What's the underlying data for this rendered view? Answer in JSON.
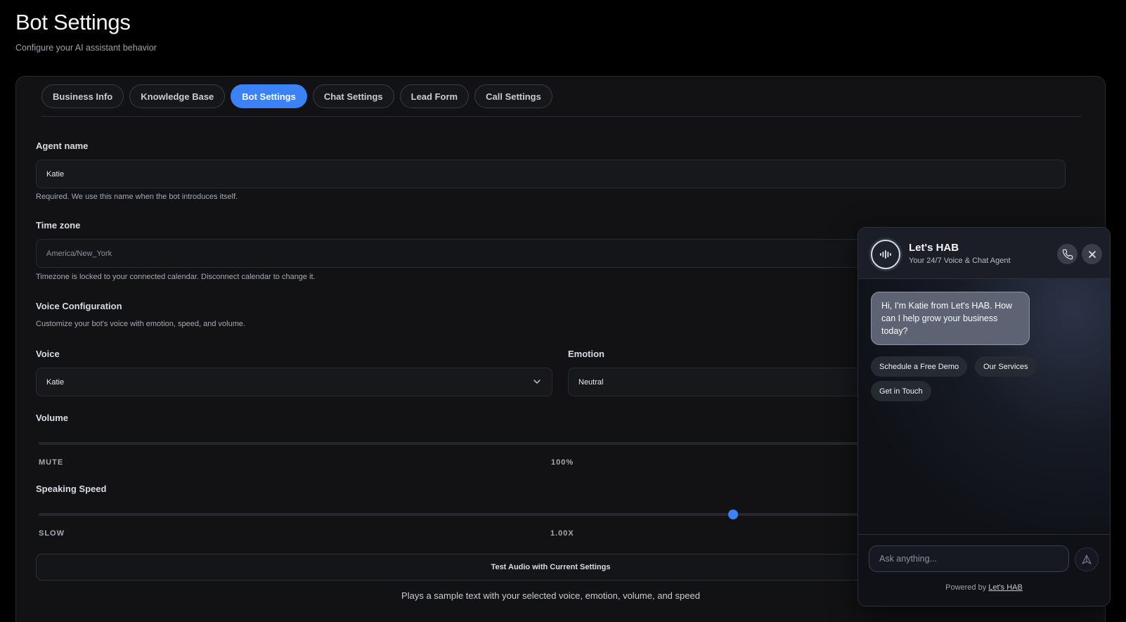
{
  "header": {
    "title": "Bot Settings",
    "subtitle": "Configure your AI assistant behavior"
  },
  "tabs": [
    {
      "label": "Business Info",
      "active": false
    },
    {
      "label": "Knowledge Base",
      "active": false
    },
    {
      "label": "Bot Settings",
      "active": true
    },
    {
      "label": "Chat Settings",
      "active": false
    },
    {
      "label": "Lead Form",
      "active": false
    },
    {
      "label": "Call Settings",
      "active": false
    }
  ],
  "agent": {
    "label": "Agent name",
    "value": "Katie",
    "help": "Required. We use this name when the bot introduces itself."
  },
  "timezone": {
    "label": "Time zone",
    "value": "America/New_York",
    "help": "Timezone is locked to your connected calendar. Disconnect calendar to change it."
  },
  "voice_config": {
    "title": "Voice Configuration",
    "description": "Customize your bot's voice with emotion, speed, and volume.",
    "voice_label": "Voice",
    "voice_value": "Katie",
    "emotion_label": "Emotion",
    "emotion_value": "Neutral"
  },
  "volume": {
    "label": "Volume",
    "min_label": "MUTE",
    "value_label": "100%"
  },
  "speed": {
    "label": "Speaking Speed",
    "min_label": "SLOW",
    "value_label": "1.00X"
  },
  "test": {
    "button_label": "Test Audio with Current Settings",
    "note": "Plays a sample text with your selected voice, emotion, volume, and speed"
  },
  "widget": {
    "name": "Let's HAB",
    "tagline": "Your 24/7 Voice & Chat Agent",
    "greeting": "Hi, I'm Katie from Let's HAB. How can I help grow your business today?",
    "chips": [
      "Schedule a Free Demo",
      "Our Services",
      "Get in Touch"
    ],
    "input_placeholder": "Ask anything...",
    "powered_prefix": "Powered by",
    "powered_link": "Let's HAB"
  },
  "colors": {
    "accent": "#3b82f6",
    "background": "#000000",
    "card": "#121214"
  },
  "icons": {
    "voice_chevron": "chevron-down-icon",
    "widget_avatar": "sound-wave-icon",
    "call": "phone-icon",
    "close": "close-icon",
    "send": "send-icon"
  }
}
